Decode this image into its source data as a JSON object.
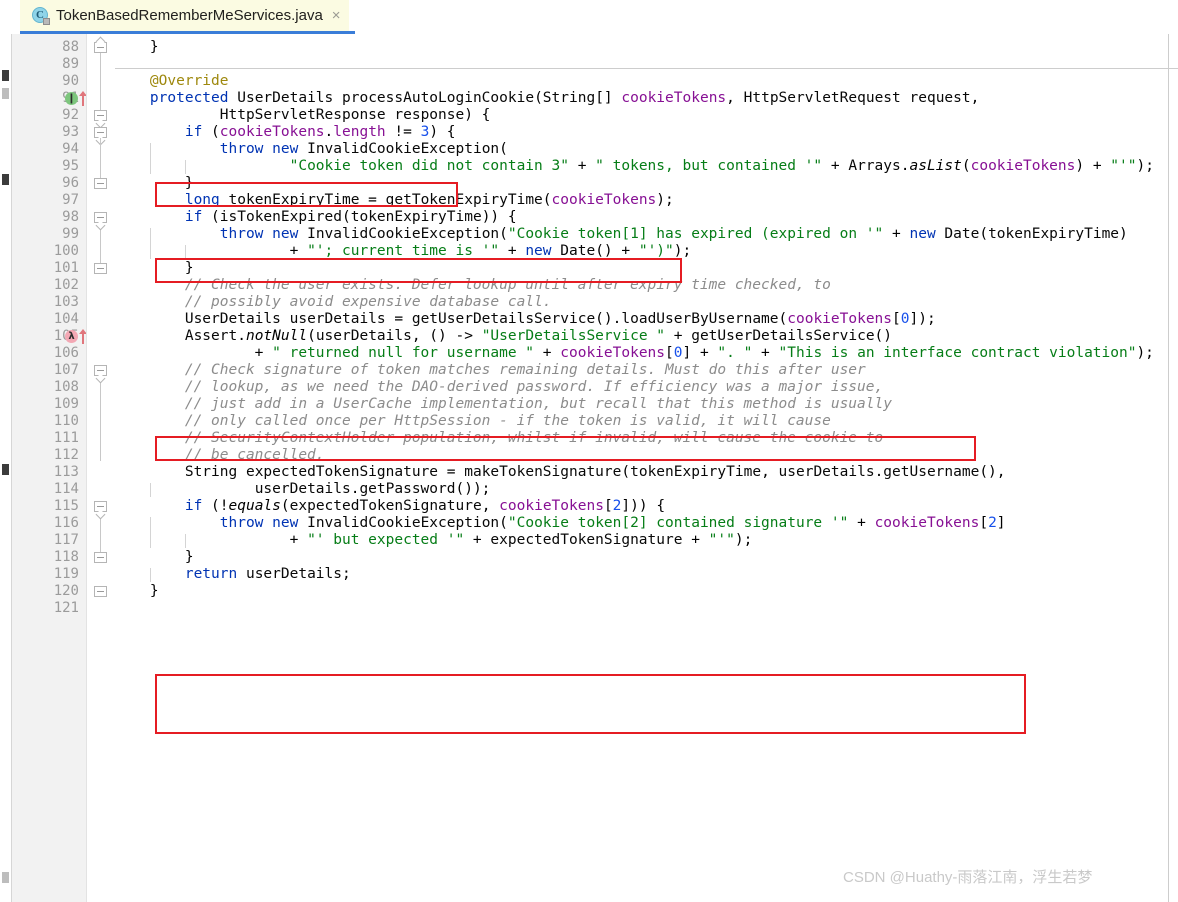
{
  "tab": {
    "title": "TokenBasedRememberMeServices.java",
    "icon": "java-class-icon",
    "icon_letter": "C",
    "close_label": "×",
    "accent_color": "#3a7dd8",
    "background_color": "#fbfbe2"
  },
  "editor": {
    "gutter_background": "#f2f2f2",
    "line_number_color": "#9b9b9b",
    "first_line": 88,
    "last_line": 121
  },
  "colors": {
    "keyword": "#0033b3",
    "string": "#067d17",
    "number": "#1750eb",
    "comment": "#8c8c8c",
    "annotation": "#9e880d",
    "field": "#871094",
    "highlight_box": "#e51c23",
    "text": "#080808"
  },
  "gutter_markers": [
    {
      "line": 91,
      "type": "implementing-method-marker",
      "glyph": "❙",
      "color": "#7dc67d",
      "arrow": "up"
    },
    {
      "line": 105,
      "type": "lambda-marker",
      "glyph": "λ",
      "color": "#f3a8b4",
      "arrow": "up"
    }
  ],
  "lines": [
    {
      "n": 88,
      "text": "    }"
    },
    {
      "n": 89,
      "text": ""
    },
    {
      "n": 90,
      "text": "    @Override"
    },
    {
      "n": 91,
      "text": "    protected UserDetails processAutoLoginCookie(String[] cookieTokens, HttpServletRequest request,"
    },
    {
      "n": 92,
      "text": "            HttpServletResponse response) {"
    },
    {
      "n": 93,
      "text": "        if (cookieTokens.length != 3) {"
    },
    {
      "n": 94,
      "text": "            throw new InvalidCookieException("
    },
    {
      "n": 95,
      "text": "                    \"Cookie token did not contain 3\" + \" tokens, but contained '\" + Arrays.asList(cookieTokens) + \"'\");"
    },
    {
      "n": 96,
      "text": "        }"
    },
    {
      "n": 97,
      "text": "        long tokenExpiryTime = getTokenExpiryTime(cookieTokens);"
    },
    {
      "n": 98,
      "text": "        if (isTokenExpired(tokenExpiryTime)) {"
    },
    {
      "n": 99,
      "text": "            throw new InvalidCookieException(\"Cookie token[1] has expired (expired on '\" + new Date(tokenExpiryTime)"
    },
    {
      "n": 100,
      "text": "                    + \"'; current time is '\" + new Date() + \"')\");"
    },
    {
      "n": 101,
      "text": "        }"
    },
    {
      "n": 102,
      "text": "        // Check the user exists. Defer lookup until after expiry time checked, to"
    },
    {
      "n": 103,
      "text": "        // possibly avoid expensive database call."
    },
    {
      "n": 104,
      "text": "        UserDetails userDetails = getUserDetailsService().loadUserByUsername(cookieTokens[0]);"
    },
    {
      "n": 105,
      "text": "        Assert.notNull(userDetails, () -> \"UserDetailsService \" + getUserDetailsService()"
    },
    {
      "n": 106,
      "text": "                + \" returned null for username \" + cookieTokens[0] + \". \" + \"This is an interface contract violation\");"
    },
    {
      "n": 107,
      "text": "        // Check signature of token matches remaining details. Must do this after user"
    },
    {
      "n": 108,
      "text": "        // lookup, as we need the DAO-derived password. If efficiency was a major issue,"
    },
    {
      "n": 109,
      "text": "        // just add in a UserCache implementation, but recall that this method is usually"
    },
    {
      "n": 110,
      "text": "        // only called once per HttpSession - if the token is valid, it will cause"
    },
    {
      "n": 111,
      "text": "        // SecurityContextHolder population, whilst if invalid, will cause the cookie to"
    },
    {
      "n": 112,
      "text": "        // be cancelled."
    },
    {
      "n": 113,
      "text": "        String expectedTokenSignature = makeTokenSignature(tokenExpiryTime, userDetails.getUsername(),"
    },
    {
      "n": 114,
      "text": "                userDetails.getPassword());"
    },
    {
      "n": 115,
      "text": "        if (!equals(expectedTokenSignature, cookieTokens[2])) {"
    },
    {
      "n": 116,
      "text": "            throw new InvalidCookieException(\"Cookie token[2] contained signature '\" + cookieTokens[2]"
    },
    {
      "n": 117,
      "text": "                    + \"' but expected '\" + expectedTokenSignature + \"'\");"
    },
    {
      "n": 118,
      "text": "        }"
    },
    {
      "n": 119,
      "text": "        return userDetails;"
    },
    {
      "n": 120,
      "text": "    }"
    },
    {
      "n": 121,
      "text": ""
    }
  ],
  "highlight_boxes": [
    {
      "name": "highlight-token-length-check",
      "lines": "93"
    },
    {
      "name": "highlight-token-expiry-time",
      "lines": "97"
    },
    {
      "name": "highlight-load-user-by-username",
      "lines": "104"
    },
    {
      "name": "highlight-expected-token-signature",
      "lines": "113-114"
    }
  ],
  "watermark": {
    "text": "CSDN @Huathy-雨落江南，浮生若梦"
  }
}
